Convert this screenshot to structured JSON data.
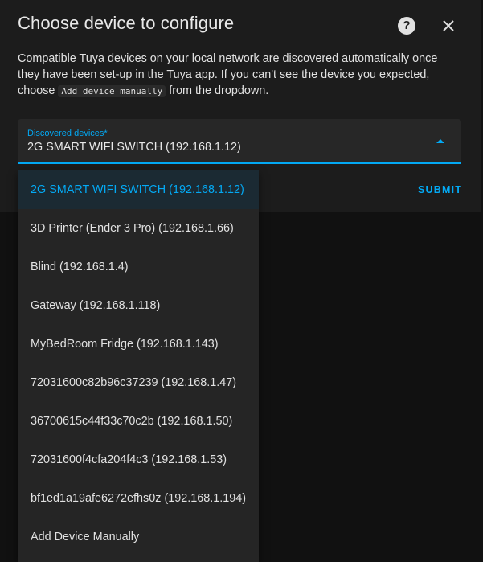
{
  "dialog": {
    "title": "Choose device to configure",
    "description_before": "Compatible Tuya devices on your local network are discovered automatically once they have been set-up in the Tuya app. If you can't see the device you expected, choose ",
    "description_code": "Add device manually",
    "description_after": " from the dropdown.",
    "help_icon": "question-circle-icon",
    "help_glyph": "?",
    "close_icon": "close-icon"
  },
  "select": {
    "label": "Discovered devices*",
    "value": "2G SMART WIFI SWITCH (192.168.1.12)",
    "arrow_icon": "arrow-up-icon"
  },
  "submit_label": "SUBMIT",
  "menu": {
    "items": [
      {
        "label": "2G SMART WIFI SWITCH (192.168.1.12)",
        "selected": true
      },
      {
        "label": "3D Printer (Ender 3 Pro) (192.168.1.66)"
      },
      {
        "label": "Blind (192.168.1.4)"
      },
      {
        "label": "Gateway (192.168.1.118)"
      },
      {
        "label": "MyBedRoom Fridge (192.168.1.143)"
      },
      {
        "label": "72031600c82b96c37239 (192.168.1.47)"
      },
      {
        "label": "36700615c44f33c70c2b (192.168.1.50)"
      },
      {
        "label": "72031600f4cfa204f4c3 (192.168.1.53)"
      },
      {
        "label": "bf1ed1a19afe6272efhs0z (192.168.1.194)"
      },
      {
        "label": "Add Device Manually"
      }
    ]
  },
  "colors": {
    "accent": "#03a9f4",
    "dialog_bg": "#1c1c1c",
    "menu_bg": "#252525",
    "selected_bg": "#1b2a33"
  }
}
